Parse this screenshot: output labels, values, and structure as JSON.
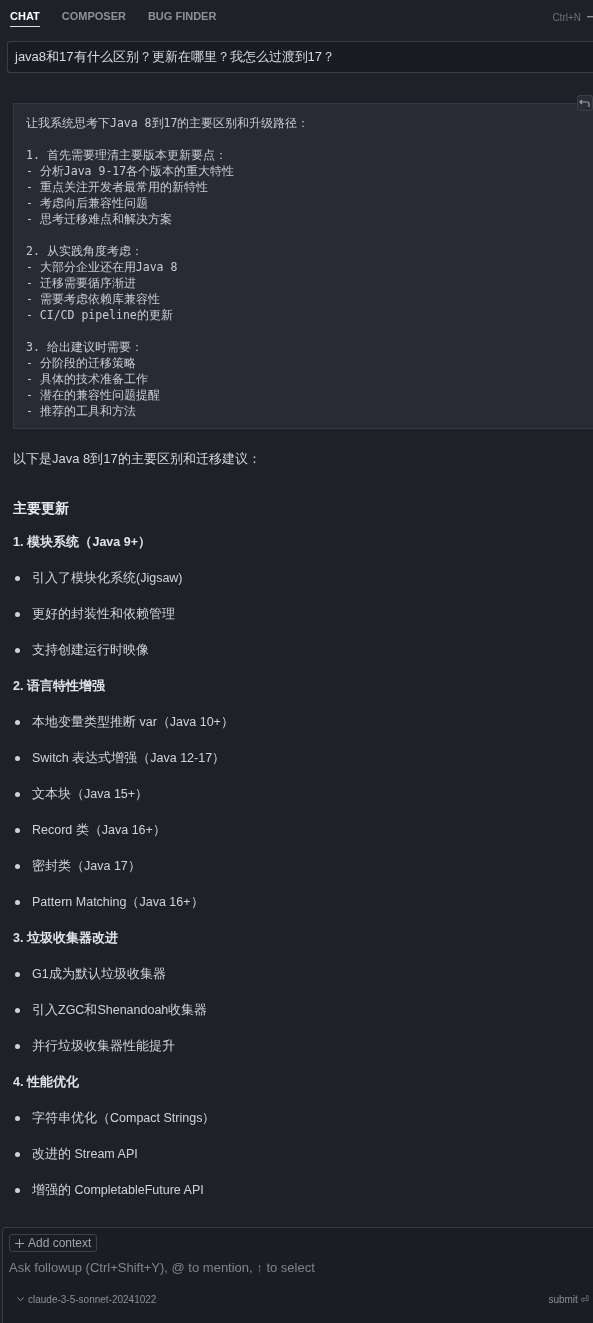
{
  "tabs": [
    {
      "label": "CHAT",
      "selected": true
    },
    {
      "label": "COMPOSER",
      "selected": false
    },
    {
      "label": "BUG FINDER",
      "selected": false
    }
  ],
  "shortcut": "Ctrl+N",
  "question": "java8和17有什么区别？更新在哪里？我怎么过渡到17？",
  "thinking": [
    [
      "让我系统思考下Java 8到17的主要区别和升级路径："
    ],
    [
      "1. 首先需要理清主要版本更新要点：",
      "- 分析Java 9-17各个版本的重大特性",
      "- 重点关注开发者最常用的新特性",
      "- 考虑向后兼容性问题",
      "- 思考迁移难点和解决方案"
    ],
    [
      "2. 从实践角度考虑：",
      "- 大部分企业还在用Java 8",
      "- 迁移需要循序渐进",
      "- 需要考虑依赖库兼容性",
      "- CI/CD pipeline的更新"
    ],
    [
      "3. 给出建议时需要：",
      "- 分阶段的迁移策略",
      "- 具体的技术准备工作",
      "- 潜在的兼容性问题提醒",
      "- 推荐的工具和方法"
    ]
  ],
  "intro": "以下是Java 8到17的主要区别和迁移建议：",
  "heading": "主要更新",
  "sections": [
    {
      "number": "1.",
      "title": "模块系统（Java 9+）",
      "items": [
        "引入了模块化系统(Jigsaw)",
        "更好的封装性和依赖管理",
        "支持创建运行时映像"
      ]
    },
    {
      "number": "2.",
      "title": "语言特性增强",
      "items": [
        "本地变量类型推断 var（Java 10+）",
        "Switch 表达式增强（Java 12-17）",
        "文本块（Java 15+）",
        "Record 类（Java 16+）",
        "密封类（Java 17）",
        "Pattern Matching（Java 16+）"
      ]
    },
    {
      "number": "3.",
      "title": "垃圾收集器改进",
      "items": [
        "G1成为默认垃圾收集器",
        "引入ZGC和Shenandoah收集器",
        "并行垃圾收集器性能提升"
      ]
    },
    {
      "number": "4.",
      "title": "性能优化",
      "items": [
        "字符串优化（Compact Strings）",
        "改进的 Stream API",
        "增强的 CompletableFuture API"
      ]
    }
  ],
  "composer": {
    "add_context": "Add context",
    "placeholder": "Ask followup (Ctrl+Shift+Y), @ to mention, ↑ to select",
    "model": "claude-3-5-sonnet-20241022",
    "submit": "submit ⏎"
  }
}
